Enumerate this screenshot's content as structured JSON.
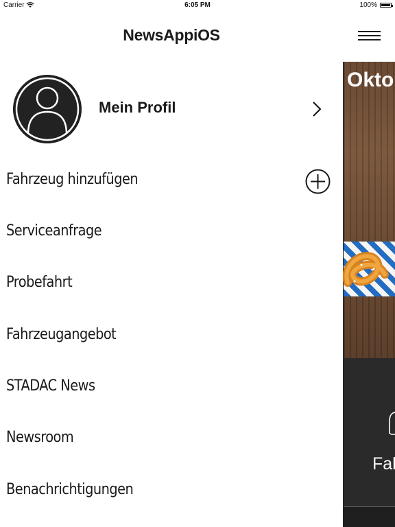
{
  "status_bar": {
    "carrier": "Carrier",
    "time": "6:05 PM",
    "battery": "100%"
  },
  "nav": {
    "title": "NewsAppiOS",
    "menu_icon": "hamburger-menu-icon"
  },
  "profile": {
    "label": "Mein Profil",
    "avatar_icon": "user-avatar-icon",
    "chevron_icon": "chevron-right-icon"
  },
  "menu": {
    "items": [
      {
        "label": "Fahrzeug hinzufügen",
        "icon": "plus-circle-icon"
      },
      {
        "label": "Serviceanfrage"
      },
      {
        "label": "Probefahrt"
      },
      {
        "label": "Fahrzeugangebot"
      },
      {
        "label": "STADAC News"
      },
      {
        "label": "Newsroom"
      },
      {
        "label": "Benachrichtigungen"
      }
    ]
  },
  "content": {
    "news_title": "Oktob",
    "card_label": "Fah",
    "colors": {
      "wood": "#6b4a34",
      "bavarian_blue": "#1f6fc9",
      "card_bg": "#2a2a2a"
    }
  }
}
